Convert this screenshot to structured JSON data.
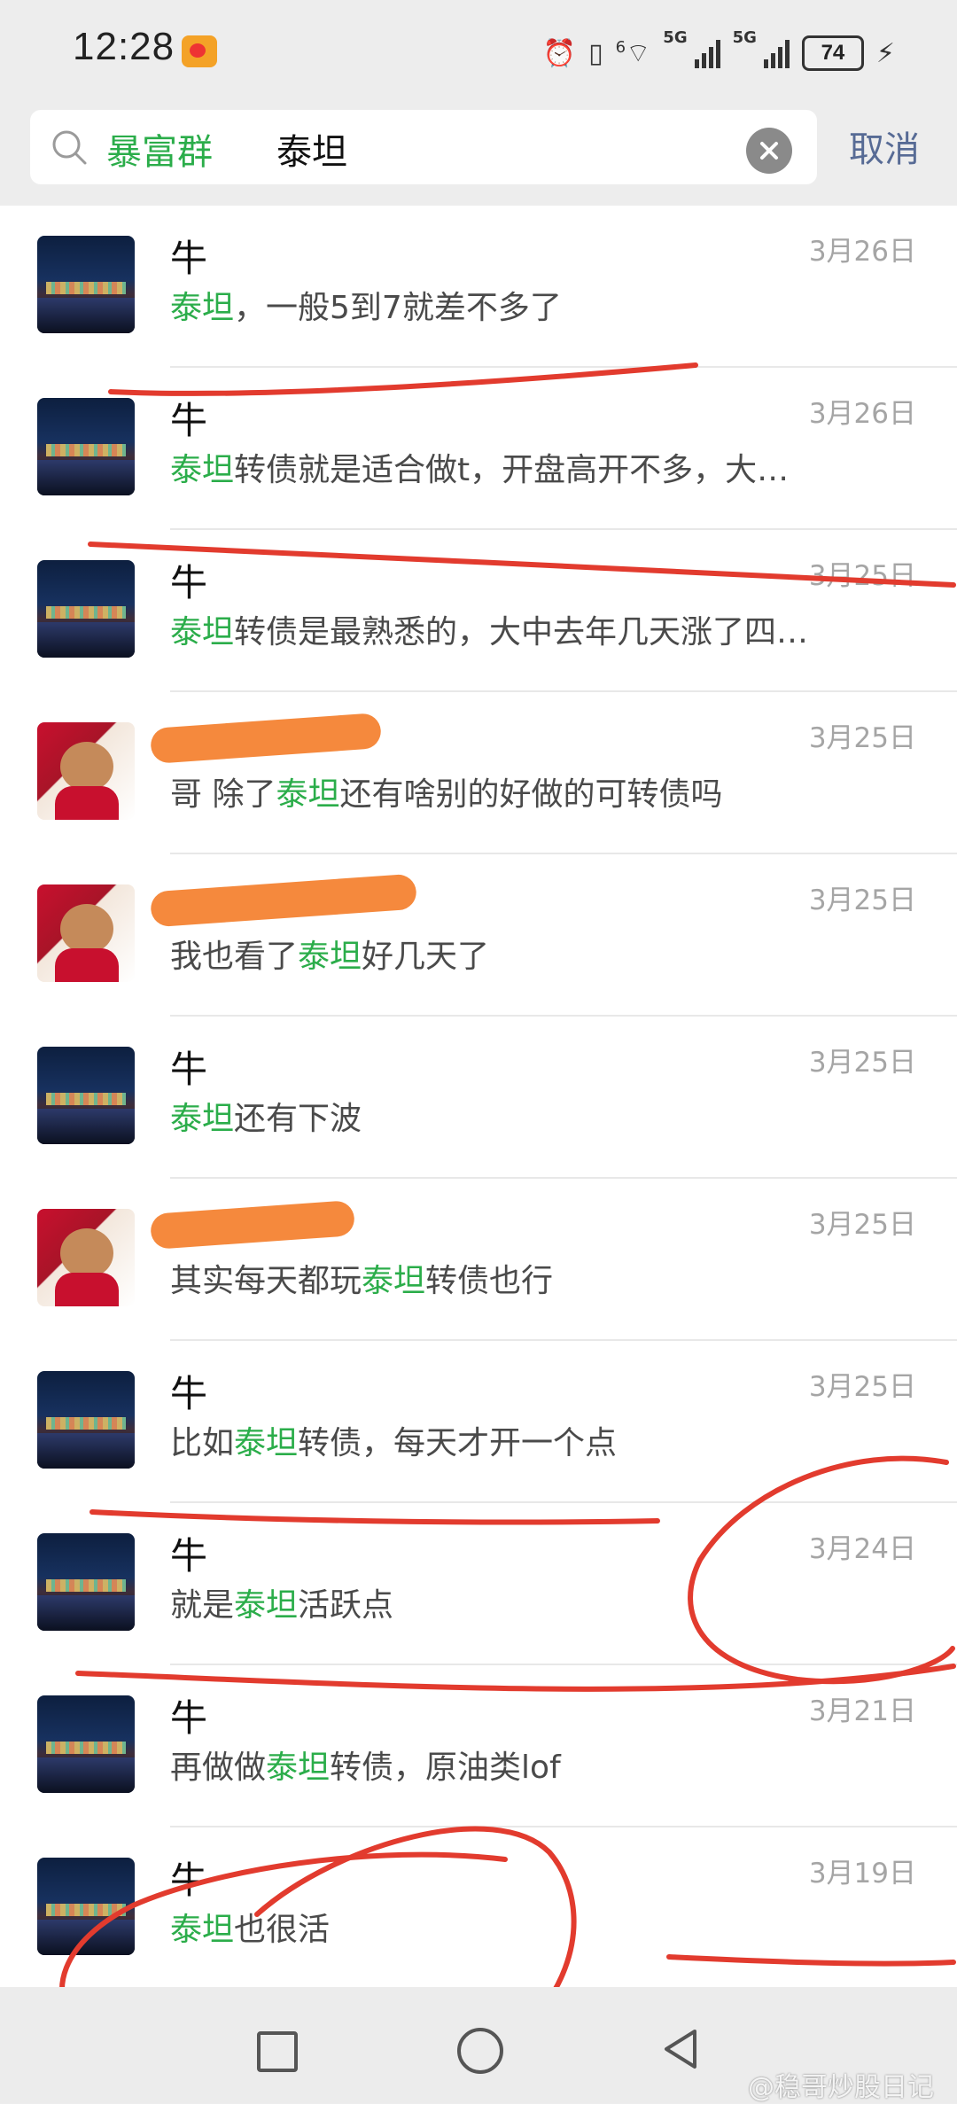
{
  "status_bar": {
    "time": "12:28",
    "network_1": "5G",
    "network_2": "5G",
    "wifi_badge": "6",
    "battery": "74"
  },
  "search": {
    "tag": "暴富群",
    "query": "泰坦",
    "cancel_label": "取消"
  },
  "results": [
    {
      "sender": "牛",
      "avatar": "night-city",
      "pre": "",
      "highlight": "泰坦",
      "post": "，一般5到7就差不多了",
      "date": "3月26日"
    },
    {
      "sender": "牛",
      "avatar": "night-city",
      "pre": "",
      "highlight": "泰坦",
      "post": "转债就是适合做t，开盘高开不多，大…",
      "date": "3月26日"
    },
    {
      "sender": "牛",
      "avatar": "night-city",
      "pre": "",
      "highlight": "泰坦",
      "post": "转债是最熟悉的，大中去年几天涨了四…",
      "date": "3月25日"
    },
    {
      "sender": "",
      "avatar": "bear",
      "pre": "哥 除了",
      "highlight": "泰坦",
      "post": "还有啥别的好做的可转债吗",
      "date": "3月25日"
    },
    {
      "sender": "",
      "avatar": "bear",
      "pre": "我也看了",
      "highlight": "泰坦",
      "post": "好几天了",
      "date": "3月25日"
    },
    {
      "sender": "牛",
      "avatar": "night-city",
      "pre": "",
      "highlight": "泰坦",
      "post": "还有下波",
      "date": "3月25日"
    },
    {
      "sender": "",
      "avatar": "bear",
      "pre": "其实每天都玩",
      "highlight": "泰坦",
      "post": "转债也行",
      "date": "3月25日"
    },
    {
      "sender": "牛",
      "avatar": "night-city",
      "pre": "比如",
      "highlight": "泰坦",
      "post": "转债，每天才开一个点",
      "date": "3月25日"
    },
    {
      "sender": "牛",
      "avatar": "night-city",
      "pre": "就是",
      "highlight": "泰坦",
      "post": "活跃点",
      "date": "3月24日"
    },
    {
      "sender": "牛",
      "avatar": "night-city",
      "pre": "再做做",
      "highlight": "泰坦",
      "post": "转债，原油类lof",
      "date": "3月21日"
    },
    {
      "sender": "牛",
      "avatar": "night-city",
      "pre": "",
      "highlight": "泰坦",
      "post": "也很活",
      "date": "3月19日"
    }
  ],
  "watermark": "@稳哥炒股日记",
  "colors": {
    "highlight": "#2bad4a",
    "cancel": "#576b95",
    "annotation": "#e23b2e",
    "redaction": "#f5893d"
  }
}
